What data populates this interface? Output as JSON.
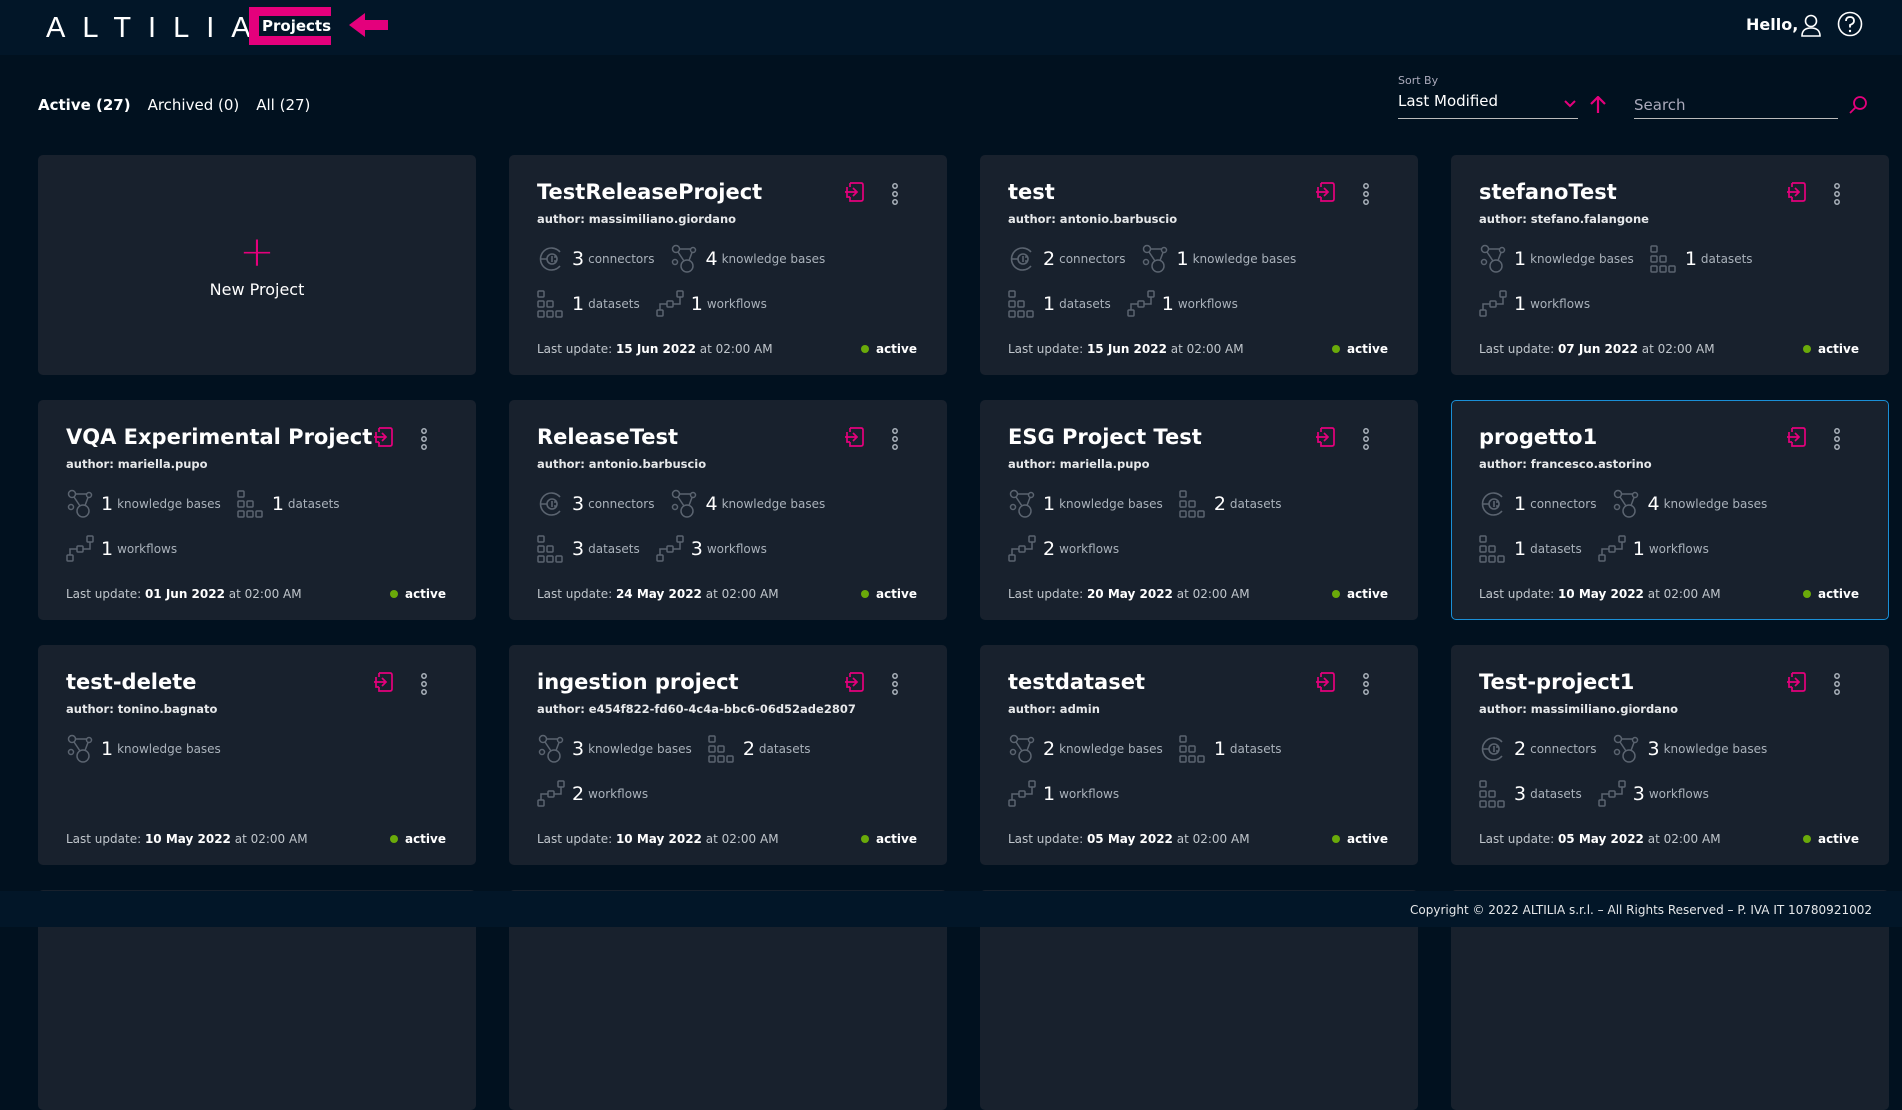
{
  "header": {
    "logo": "ALTILIA",
    "section": "Projects",
    "greeting": "Hello,"
  },
  "colors": {
    "accent": "#e4007c",
    "status_active": "#6aaa0a",
    "selected_border": "#1a8fd6"
  },
  "tabs": [
    {
      "label": "Active (27)",
      "active": true
    },
    {
      "label": "Archived (0)"
    },
    {
      "label": "All (27)"
    }
  ],
  "sort": {
    "label": "Sort By",
    "value": "Last Modified",
    "direction": "ascending"
  },
  "search": {
    "placeholder": "Search"
  },
  "new_project": {
    "label": "New Project"
  },
  "update_prefix": "Last update: ",
  "projects": [
    {
      "title": "TestReleaseProject",
      "author": "author: massimiliano.giordano",
      "stats": [
        [
          "connectors",
          3
        ],
        [
          "knowledge bases",
          4
        ],
        [
          "datasets",
          1
        ],
        [
          "workflows",
          1
        ]
      ],
      "date": "15 Jun 2022",
      "time": " at 02:00 AM",
      "status": "active"
    },
    {
      "title": "test",
      "author": "author: antonio.barbuscio",
      "stats": [
        [
          "connectors",
          2
        ],
        [
          "knowledge bases",
          1
        ],
        [
          "datasets",
          1
        ],
        [
          "workflows",
          1
        ]
      ],
      "date": "15 Jun 2022",
      "time": " at 02:00 AM",
      "status": "active"
    },
    {
      "title": "stefanoTest",
      "author": "author: stefano.falangone",
      "stats": [
        [
          "knowledge bases",
          1
        ],
        [
          "datasets",
          1
        ],
        [
          "workflows",
          1
        ]
      ],
      "date": "07 Jun 2022",
      "time": " at 02:00 AM",
      "status": "active"
    },
    {
      "title": "VQA Experimental Project",
      "author": "author: mariella.pupo",
      "stats": [
        [
          "knowledge bases",
          1
        ],
        [
          "datasets",
          1
        ],
        [
          "workflows",
          1
        ]
      ],
      "date": "01 Jun 2022",
      "time": " at 02:00 AM",
      "status": "active"
    },
    {
      "title": "ReleaseTest",
      "author": "author: antonio.barbuscio",
      "stats": [
        [
          "connectors",
          3
        ],
        [
          "knowledge bases",
          4
        ],
        [
          "datasets",
          3
        ],
        [
          "workflows",
          3
        ]
      ],
      "date": "24 May 2022",
      "time": " at 02:00 AM",
      "status": "active"
    },
    {
      "title": "ESG Project Test",
      "author": "author: mariella.pupo",
      "stats": [
        [
          "knowledge bases",
          1
        ],
        [
          "datasets",
          2
        ],
        [
          "workflows",
          2
        ]
      ],
      "date": "20 May 2022",
      "time": " at 02:00 AM",
      "status": "active"
    },
    {
      "title": "progetto1",
      "author": "author: francesco.astorino",
      "stats": [
        [
          "connectors",
          1
        ],
        [
          "knowledge bases",
          4
        ],
        [
          "datasets",
          1
        ],
        [
          "workflows",
          1
        ]
      ],
      "date": "10 May 2022",
      "time": " at 02:00 AM",
      "status": "active",
      "selected": true
    },
    {
      "title": "test-delete",
      "author": "author: tonino.bagnato",
      "stats": [
        [
          "knowledge bases",
          1
        ]
      ],
      "date": "10 May 2022",
      "time": " at 02:00 AM",
      "status": "active"
    },
    {
      "title": "ingestion project",
      "author": "author: e454f822-fd60-4c4a-bbc6-06d52ade2807",
      "stats": [
        [
          "knowledge bases",
          3
        ],
        [
          "datasets",
          2
        ],
        [
          "workflows",
          2
        ]
      ],
      "date": "10 May 2022",
      "time": " at 02:00 AM",
      "status": "active"
    },
    {
      "title": "testdataset",
      "author": "author: admin",
      "stats": [
        [
          "knowledge bases",
          2
        ],
        [
          "datasets",
          1
        ],
        [
          "workflows",
          1
        ]
      ],
      "date": "05 May 2022",
      "time": " at 02:00 AM",
      "status": "active"
    },
    {
      "title": "Test-project1",
      "author": "author: massimiliano.giordano",
      "stats": [
        [
          "connectors",
          2
        ],
        [
          "knowledge bases",
          3
        ],
        [
          "datasets",
          3
        ],
        [
          "workflows",
          3
        ]
      ],
      "date": "05 May 2022",
      "time": " at 02:00 AM",
      "status": "active"
    }
  ],
  "footer": {
    "copyright": "Copyright © 2022 ALTILIA s.r.l. – All Rights Reserved – P. IVA IT 10780921002"
  }
}
